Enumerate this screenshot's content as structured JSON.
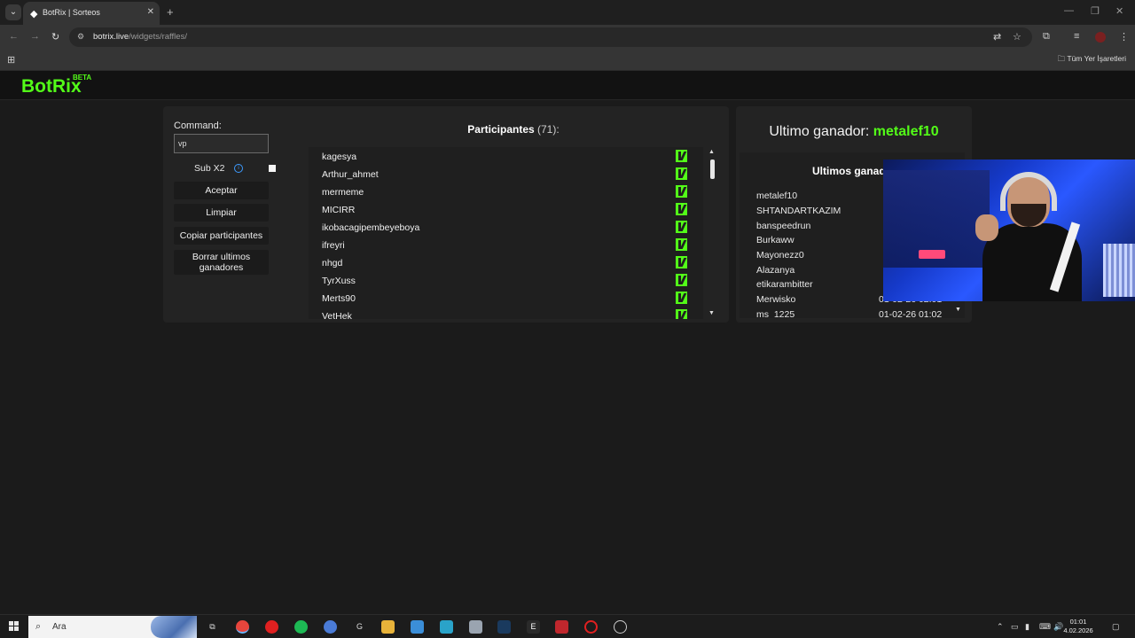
{
  "browser": {
    "tab_title": "BotRix | Sorteos",
    "url_host": "botrix.live",
    "url_path": "/widgets/raffles/",
    "bookmark_folder": "Tüm Yer İşaretleri"
  },
  "site": {
    "logo": "BotRix",
    "logo_badge": "BETA"
  },
  "raffle": {
    "command_label": "Command:",
    "command_value": "vp",
    "sub_x2_label": "Sub X2",
    "sub_x2_checked": false,
    "buttons": {
      "accept": "Aceptar",
      "clear": "Limpiar",
      "copy": "Copiar participantes",
      "delete_winners": "Borrar ultimos ganadores"
    },
    "participants_title": "Participantes",
    "participants_count": "(71):",
    "participants": [
      "kagesya",
      "Arthur_ahmet",
      "mermeme",
      "MICIRR",
      "ikobacagipembeyeboya",
      "ifreyri",
      "nhgd",
      "TyrXuss",
      "Merts90",
      "VetHek"
    ]
  },
  "winner_panel": {
    "last_winner_label": "Ultimo ganador:",
    "last_winner_name": "metalef10",
    "recent_title": "Ultimos ganado",
    "recent": [
      {
        "name": "metalef10",
        "date": ""
      },
      {
        "name": "SHTANDARTKAZIM",
        "date": ""
      },
      {
        "name": "banspeedrun",
        "date": ""
      },
      {
        "name": "Burkaww",
        "date": ""
      },
      {
        "name": "Mayonezz0",
        "date": ""
      },
      {
        "name": "Alazanya",
        "date": ""
      },
      {
        "name": "etikarambitter",
        "date": ""
      },
      {
        "name": "Merwisko",
        "date": "01-02-26 02:01"
      },
      {
        "name": "ms_1225",
        "date": "01-02-26 01:02"
      }
    ]
  },
  "taskbar": {
    "search_placeholder": "Ara",
    "time": "01:01",
    "date": "4.02.2026"
  },
  "colors": {
    "accent_green": "#53fc18",
    "panel_bg": "#232323",
    "page_bg": "#1b1b1b"
  }
}
